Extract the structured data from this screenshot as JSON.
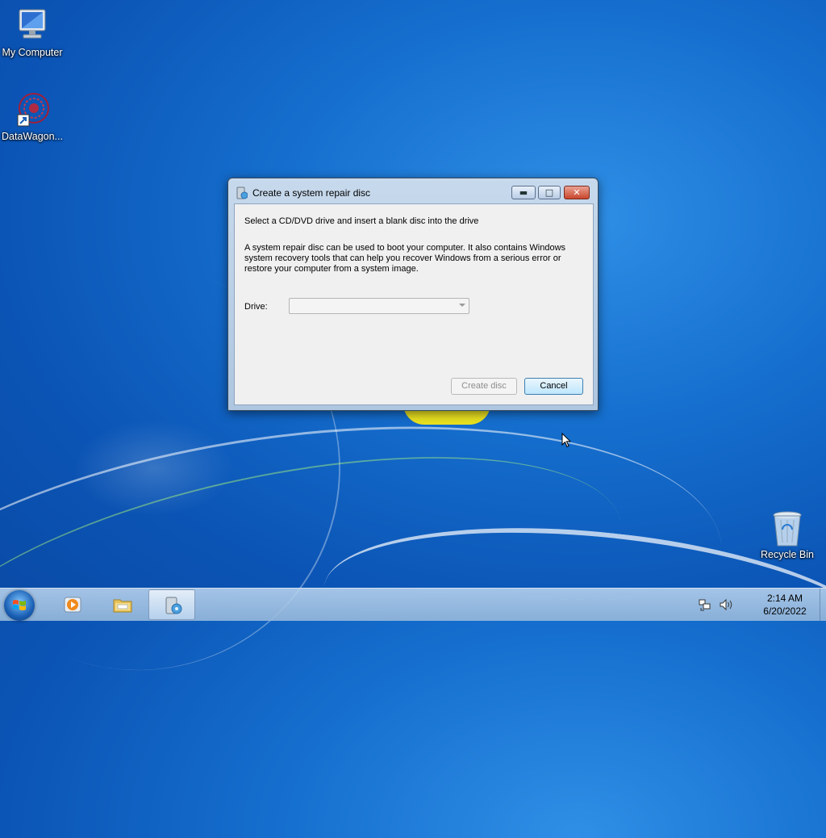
{
  "desktop": {
    "icons": [
      {
        "label": "My Computer",
        "icon": "computer-icon"
      },
      {
        "label": "DataWagon...",
        "icon": "datawagon-shortcut-icon"
      },
      {
        "label": "Recycle Bin",
        "icon": "recycle-bin-icon"
      }
    ]
  },
  "dialog": {
    "title": "Create a system repair disc",
    "heading": "Select a CD/DVD drive and insert a blank disc into the drive",
    "description": "A system repair disc can be used to boot your computer. It also contains Windows system recovery tools that can help you recover Windows from a serious error or restore your computer from a system image.",
    "drive_label": "Drive:",
    "drive_value": "",
    "create_button": "Create disc",
    "cancel_button": "Cancel"
  },
  "taskbar": {
    "items": [
      {
        "icon": "windows-media-player-icon",
        "active": false
      },
      {
        "icon": "file-explorer-icon",
        "active": false
      },
      {
        "icon": "repair-disc-app-icon",
        "active": true
      }
    ],
    "tray_icons": [
      "network-icon",
      "volume-icon"
    ],
    "time": "2:14 AM",
    "date": "6/20/2022"
  },
  "colors": {
    "desktop_blue": "#1670cf",
    "close_red": "#c9462c",
    "button_focus": "#3c7fb1"
  }
}
